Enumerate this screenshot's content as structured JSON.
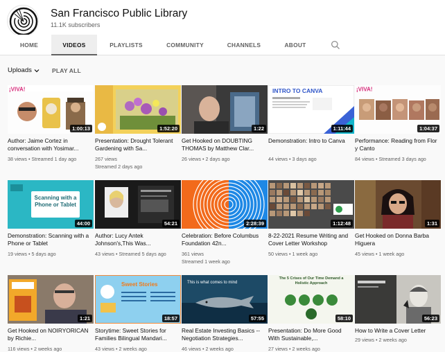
{
  "channel": {
    "name": "San Francisco Public Library",
    "subscribers": "11.1K subscribers"
  },
  "tabs": [
    {
      "label": "HOME",
      "active": false
    },
    {
      "label": "VIDEOS",
      "active": true
    },
    {
      "label": "PLAYLISTS",
      "active": false
    },
    {
      "label": "COMMUNITY",
      "active": false
    },
    {
      "label": "CHANNELS",
      "active": false
    },
    {
      "label": "ABOUT",
      "active": false
    }
  ],
  "toolbar": {
    "sort_label": "Uploads",
    "play_all": "PLAY ALL"
  },
  "thumb_text": {
    "viva": "¡VIVA!",
    "intro_canva": "INTRO TO CANVA",
    "scanning": "Scanning with a Phone or Tablet",
    "sweet_stories": "Sweet Stories",
    "real_estate": "This is what comes to mind",
    "crises": "The 5 Crises of Our Time Demand a Holistic Approach"
  },
  "videos": [
    {
      "title": "Author: Jaime Cortez in conversation with Yosimar...",
      "views": "38 views",
      "age": "Streamed 1 day ago",
      "duration": "1:00:13"
    },
    {
      "title": "Presentation: Drought Tolerant Gardening with Sa...",
      "views": "267 views",
      "age": "Streamed 2 days ago",
      "duration": "1:52:20"
    },
    {
      "title": "Get Hooked on DOUBTING THOMAS by Matthew Clar...",
      "views": "26 views",
      "age": "2 days ago",
      "duration": "1:22"
    },
    {
      "title": "Demonstration: Intro to Canva",
      "views": "44 views",
      "age": "3 days ago",
      "duration": "1:11:44"
    },
    {
      "title": "Performance: Reading from Flor y Canto",
      "views": "84 views",
      "age": "Streamed 3 days ago",
      "duration": "1:04:37"
    },
    {
      "title": "Demonstration: Scanning with a Phone or Tablet",
      "views": "19 views",
      "age": "5 days ago",
      "duration": "44:00"
    },
    {
      "title": "Author: Lucy Antek Johnson's,This Was...",
      "views": "43 views",
      "age": "Streamed 5 days ago",
      "duration": "54:21"
    },
    {
      "title": "Celebration: Before Columbus Foundation 42n...",
      "views": "361 views",
      "age": "Streamed 1 week ago",
      "duration": "2:28:39"
    },
    {
      "title": "8-22-2021 Resume Writing and Cover Letter Workshop",
      "views": "50 views",
      "age": "1 week ago",
      "duration": "1:12:48"
    },
    {
      "title": "Get Hooked on Donna Barba Higuera",
      "views": "45 views",
      "age": "1 week ago",
      "duration": "1:31"
    },
    {
      "title": "Get Hooked on NOIRYORICAN by Richie...",
      "views": "116 views",
      "age": "2 weeks ago",
      "duration": "1:21"
    },
    {
      "title": "Storytime: Sweet Stories for Families Bilingual Mandari...",
      "views": "43 views",
      "age": "2 weeks ago",
      "duration": "18:57"
    },
    {
      "title": "Real Estate Investing Basics -- Negotiation Strategies...",
      "views": "46 views",
      "age": "2 weeks ago",
      "duration": "57:55"
    },
    {
      "title": "Presentation: Do More Good With Sustainable,...",
      "views": "27 views",
      "age": "2 weeks ago",
      "duration": "58:10"
    },
    {
      "title": "How to Write a Cover Letter",
      "views": "29 views",
      "age": "2 weeks ago",
      "duration": "56:23"
    }
  ]
}
